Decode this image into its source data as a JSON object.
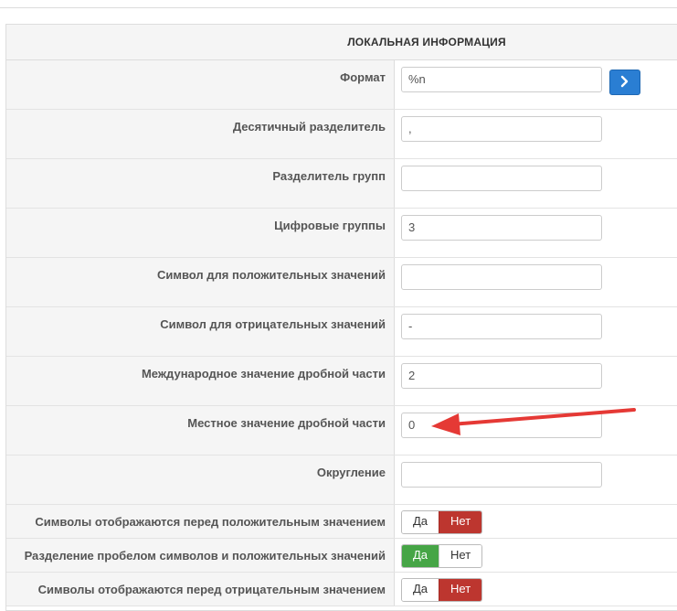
{
  "section": {
    "title": "ЛОКАЛЬНАЯ ИНФОРМАЦИЯ"
  },
  "fields": {
    "format": {
      "label": "Формат",
      "value": "%n"
    },
    "decimal_separator": {
      "label": "Десятичный разделитель",
      "value": ","
    },
    "group_separator": {
      "label": "Разделитель групп",
      "value": ""
    },
    "digit_groups": {
      "label": "Цифровые группы",
      "value": "3"
    },
    "positive_sign": {
      "label": "Символ для положительных значений",
      "value": ""
    },
    "negative_sign": {
      "label": "Символ для отрицательных значений",
      "value": "-"
    },
    "intl_frac_digits": {
      "label": "Международное значение дробной части",
      "value": "2"
    },
    "local_frac_digits": {
      "label": "Местное значение дробной части",
      "value": "0"
    },
    "rounding": {
      "label": "Округление",
      "value": ""
    }
  },
  "toggles": {
    "yes_label": "Да",
    "no_label": "Нет",
    "pos_cs_precedes": {
      "label": "Символы отображаются перед положительным значением",
      "selected": "Нет"
    },
    "pos_sep_by_space": {
      "label": "Разделение пробелом символов и положительных значений",
      "selected": "Да"
    },
    "neg_cs_precedes": {
      "label": "Символы отображаются перед отрицательным значением",
      "selected": "Нет"
    }
  },
  "icons": {
    "go_button": "chevron-right-icon"
  },
  "colors": {
    "primary": "#2a7ed3",
    "danger": "#bd362f",
    "success": "#46a546",
    "annotation": "#e53935"
  }
}
